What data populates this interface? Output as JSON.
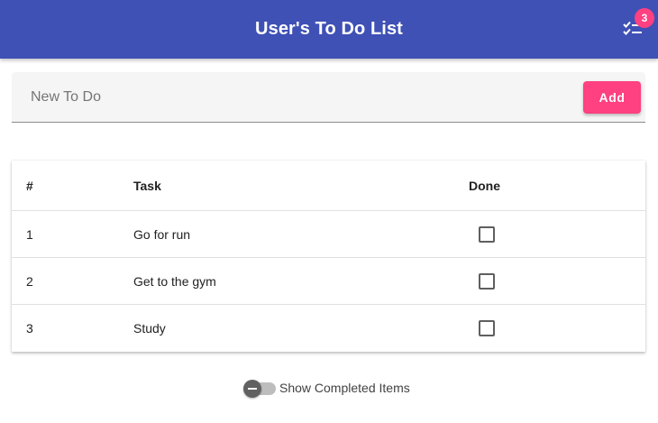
{
  "header": {
    "title": "User's To Do List",
    "tasks_icon": "checklist-icon",
    "badge_count": "3"
  },
  "new_todo": {
    "placeholder": "New To Do",
    "value": "",
    "add_label": "Add"
  },
  "table": {
    "columns": [
      "#",
      "Task",
      "Done"
    ],
    "rows": [
      {
        "num": "1",
        "task": "Go for run",
        "done": false
      },
      {
        "num": "2",
        "task": "Get to the gym",
        "done": false
      },
      {
        "num": "3",
        "task": "Study",
        "done": false
      }
    ]
  },
  "show_completed": {
    "label": "Show Completed Items",
    "enabled": false
  },
  "colors": {
    "primary": "#3f51b5",
    "accent": "#ff4081"
  }
}
